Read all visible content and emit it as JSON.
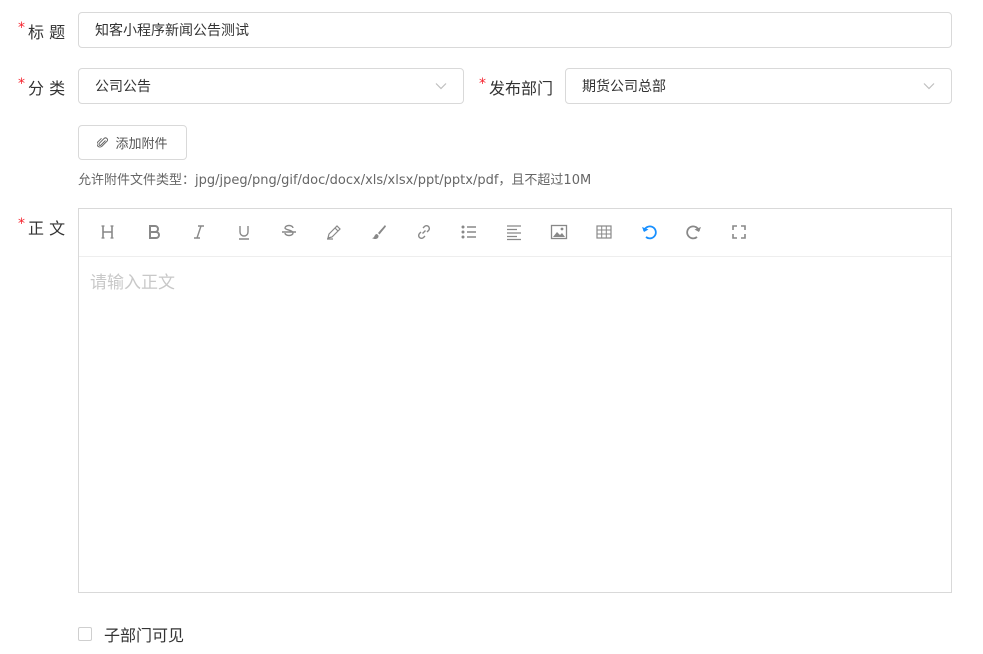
{
  "form": {
    "title_label": "标 题",
    "title_value": "知客小程序新闻公告测试",
    "category_label": "分 类",
    "category_value": "公司公告",
    "department_label": "发布部门",
    "department_value": "期货公司总部",
    "attach_button": "添加附件",
    "attach_hint": "允许附件文件类型：jpg/jpeg/png/gif/doc/docx/xls/xlsx/ppt/pptx/pdf，且不超过10M",
    "body_label": "正 文",
    "body_placeholder": "请输入正文",
    "subdept_label": "子部门可见",
    "required_mark": "*"
  },
  "toolbar": {
    "icons": [
      "heading-icon",
      "bold-icon",
      "italic-icon",
      "underline-icon",
      "strikethrough-icon",
      "highlight-icon",
      "brush-icon",
      "link-icon",
      "bullet-list-icon",
      "align-icon",
      "image-icon",
      "table-icon",
      "undo-icon",
      "redo-icon",
      "fullscreen-icon"
    ]
  },
  "colors": {
    "required": "#f5222d",
    "accent": "#1890ff",
    "border": "#d9d9d9"
  }
}
